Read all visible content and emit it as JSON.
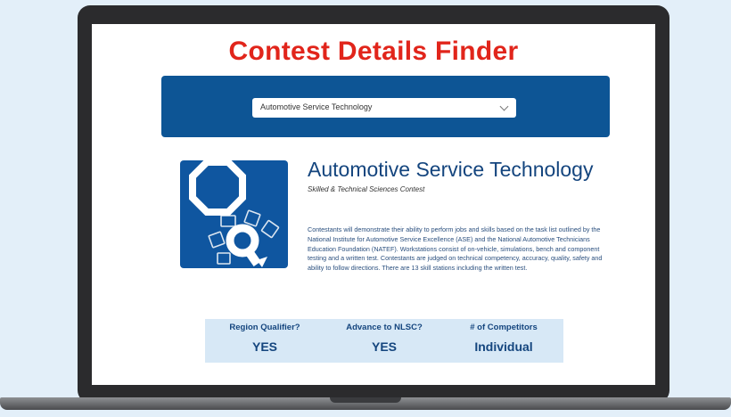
{
  "page": {
    "title": "Contest Details Finder"
  },
  "selector": {
    "selected": "Automotive Service Technology",
    "icon": "chevron-down-icon"
  },
  "contest": {
    "name": "Automotive Service Technology",
    "category": "Skilled & Technical Sciences Contest",
    "icon": "gear-wrench-icon",
    "description": "Contestants will demonstrate their ability to perform jobs and skills based on the task list outlined by the National Institute for Automotive Service Excellence (ASE) and the National Automotive Technicians Education Foundation (NATEF). Workstations consist of on-vehicle, simulations, bench and component testing and a written test. Contestants are judged on technical competency, accuracy, quality, safety and ability to follow directions. There are 13 skill stations including the written test."
  },
  "stats": [
    {
      "label": "Region Qualifier?",
      "value": "YES"
    },
    {
      "label": "Advance to NLSC?",
      "value": "YES"
    },
    {
      "label": "# of Competitors",
      "value": "Individual"
    }
  ],
  "colors": {
    "title_red": "#e1251b",
    "panel_blue": "#0d5595",
    "navy_text": "#14457e",
    "stats_bg": "#d7e8f6"
  }
}
